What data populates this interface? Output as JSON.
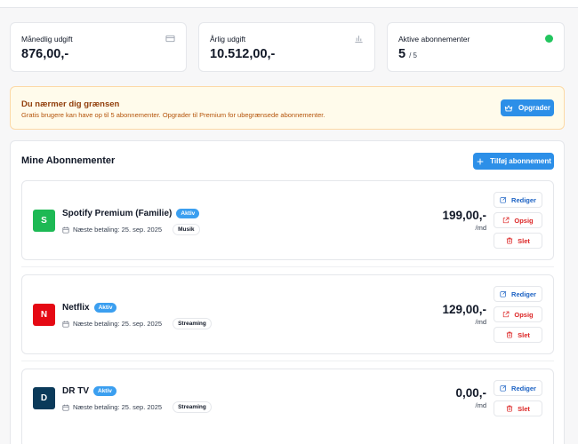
{
  "colors": {
    "accent": "#2c8fe8",
    "success": "#22c55e",
    "danger": "#dc2626",
    "warning_bg": "#fffbeb",
    "warning_text": "#92400e"
  },
  "stats": [
    {
      "label": "Månedlig udgift",
      "value": "876,00,-",
      "icon": "credit-card-icon"
    },
    {
      "label": "Årlig udgift",
      "value": "10.512,00,-",
      "icon": "bar-chart-icon"
    },
    {
      "label": "Aktive abonnementer",
      "value": "5",
      "suffix": "/ 5",
      "icon": "status-dot"
    }
  ],
  "banner": {
    "title": "Du nærmer dig grænsen",
    "text": "Gratis brugere kan have op til 5 abonnementer. Opgrader til Premium for ubegrænsede abonnementer.",
    "button_label": "Opgrader",
    "button_icon": "crown-icon"
  },
  "panel": {
    "title": "Mine Abonnementer",
    "add_button_label": "Tilføj abonnement",
    "add_button_icon": "plus-icon"
  },
  "labels": {
    "next_payment_prefix": "Næste betaling:",
    "edit": "Rediger",
    "cancel": "Opsig",
    "delete": "Slet"
  },
  "subscriptions": [
    {
      "letter": "S",
      "name": "Spotify Premium (Familie)",
      "status": "Aktiv",
      "next_payment": "Næste betaling: 25. sep. 2025",
      "category": "Musik",
      "price": "199,00,-",
      "period": "/md",
      "avatar_color": "#1db954"
    },
    {
      "letter": "N",
      "name": "Netflix",
      "status": "Aktiv",
      "next_payment": "Næste betaling: 25. sep. 2025",
      "category": "Streaming",
      "price": "129,00,-",
      "period": "/md",
      "avatar_color": "#e50914"
    },
    {
      "letter": "D",
      "name": "DR TV",
      "status": "Aktiv",
      "next_payment": "Næste betaling: 25. sep. 2025",
      "category": "Streaming",
      "price": "0,00,-",
      "period": "/md",
      "avatar_color": "#0b3a5a"
    }
  ]
}
